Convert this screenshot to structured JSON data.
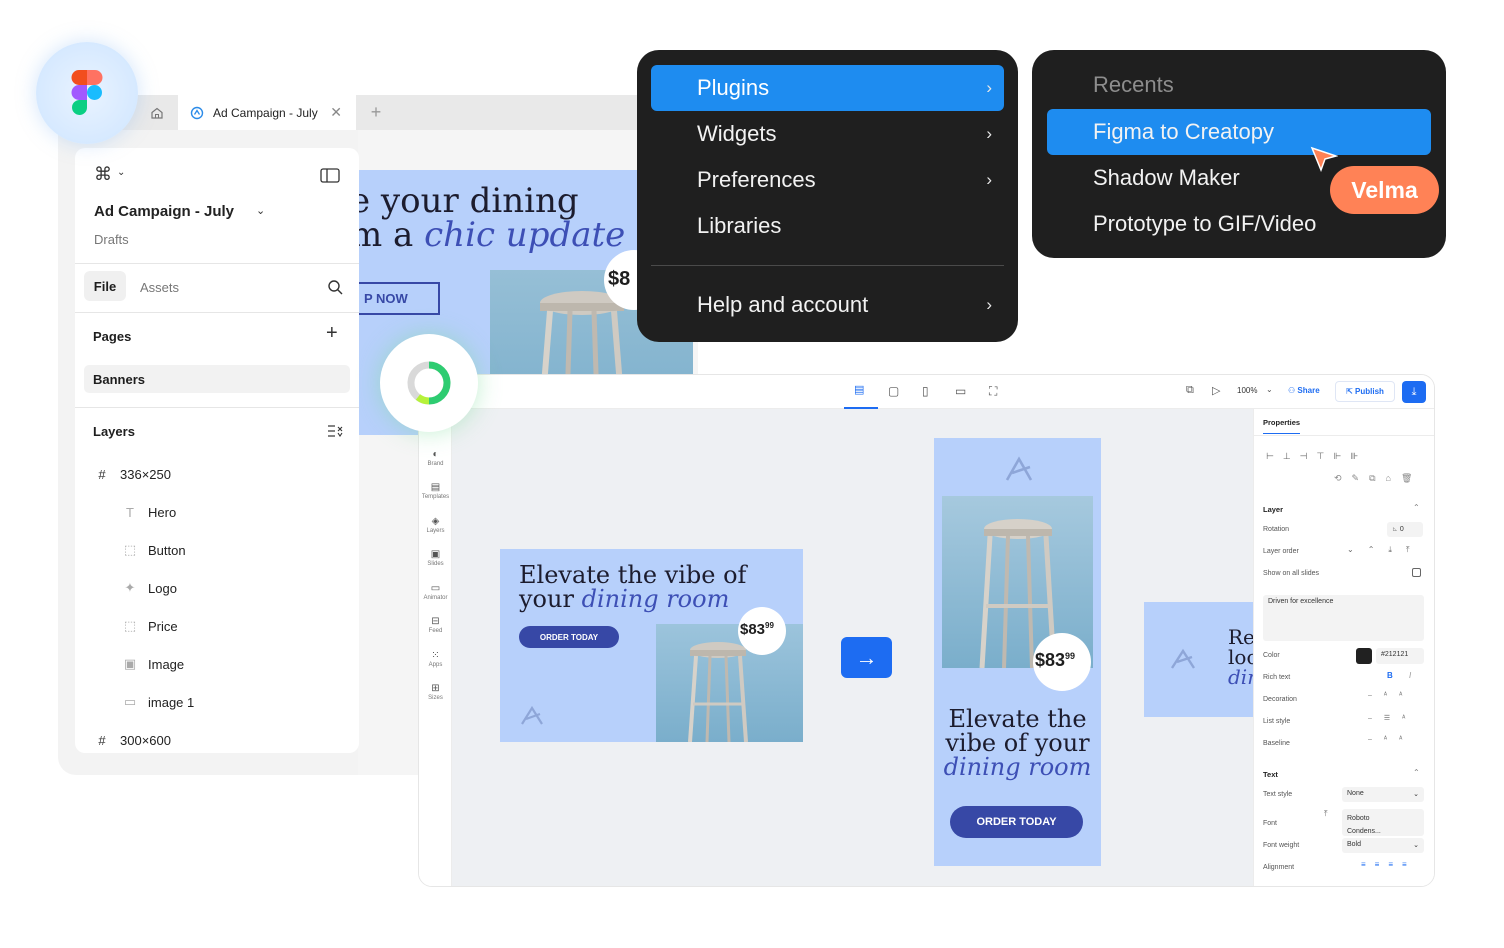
{
  "figma": {
    "tab_title": "Ad Campaign - July",
    "file_name": "Ad Campaign - July",
    "file_location": "Drafts",
    "tabs": [
      "File",
      "Assets"
    ],
    "pages_label": "Pages",
    "pages": [
      "Banners"
    ],
    "layers_label": "Layers",
    "layers": [
      {
        "name": "336×250",
        "icon": "frame-icon",
        "level": 0
      },
      {
        "name": "Hero",
        "icon": "text-icon",
        "level": 1
      },
      {
        "name": "Button",
        "icon": "component-icon",
        "level": 1
      },
      {
        "name": "Logo",
        "icon": "vector-icon",
        "level": 1
      },
      {
        "name": "Price",
        "icon": "component-icon",
        "level": 1
      },
      {
        "name": "Image",
        "icon": "image-icon",
        "level": 1
      },
      {
        "name": "image 1",
        "icon": "rectangle-icon",
        "level": 1
      },
      {
        "name": "300×600",
        "icon": "frame-icon",
        "level": 0
      }
    ],
    "background_banner": {
      "headline_1": "e your dining",
      "headline_2_plain": "m a ",
      "headline_2_italic": "chic update",
      "button": "P NOW",
      "price": "$8"
    }
  },
  "plugins_menu": {
    "items": [
      {
        "label": "Plugins",
        "active": true,
        "submenu": true
      },
      {
        "label": "Widgets",
        "active": false,
        "submenu": true
      },
      {
        "label": "Preferences",
        "active": false,
        "submenu": true
      },
      {
        "label": "Libraries",
        "active": false,
        "submenu": false
      }
    ],
    "footer_item": {
      "label": "Help and account",
      "submenu": true
    }
  },
  "recents_menu": {
    "title": "Recents",
    "items": [
      {
        "label": "Figma to Creatopy",
        "active": true
      },
      {
        "label": "Shadow Maker",
        "active": false
      },
      {
        "label": "Prototype to GIF/Video",
        "active": false
      }
    ]
  },
  "cursor_label": "Velma",
  "creatopy": {
    "toolbar": {
      "zoom": "100%",
      "share": "Share",
      "publish": "Publish"
    },
    "sidebar": [
      "Brand",
      "Templates",
      "Layers",
      "Slides",
      "Animator",
      "Feed",
      "Apps",
      "Sizes"
    ],
    "properties": {
      "tab": "Properties",
      "layer_section": "Layer",
      "rotation_label": "Rotation",
      "rotation_value": "0",
      "layer_order_label": "Layer order",
      "show_all_slides_label": "Show on all slides",
      "text_preview": "Driven for excellence",
      "color_label": "Color",
      "color_value": "#212121",
      "rich_text_label": "Rich text",
      "decoration_label": "Decoration",
      "list_style_label": "List style",
      "baseline_label": "Baseline",
      "text_section": "Text",
      "text_style_label": "Text style",
      "text_style_value": "None",
      "font_label": "Font",
      "font_value_1": "Roboto",
      "font_value_2": "Condens...",
      "font_weight_label": "Font weight",
      "font_weight_value": "Bold",
      "alignment_label": "Alignment"
    },
    "banner_horizontal": {
      "headline_1": "Elevate the vibe of",
      "headline_2_plain": "your ",
      "headline_2_italic": "dining room",
      "button": "ORDER TODAY",
      "price": "$83",
      "price_cents": "99"
    },
    "banner_vertical": {
      "headline_1": "Elevate the",
      "headline_2": "vibe of your",
      "headline_3_italic": "dining room",
      "button": "ORDER TODAY",
      "price": "$83",
      "price_cents": "99"
    },
    "banner_partial": {
      "line_1": "Re",
      "line_2": "loo",
      "line_3_italic": "din"
    }
  },
  "colors": {
    "accent_blue": "#1e8cf0",
    "menu_dark": "#1f1f1f",
    "cursor_orange": "#ff8256",
    "banner_blue": "#b7d0fb",
    "banner_button": "#3748a6",
    "creatopy_blue": "#1d6cf2"
  }
}
